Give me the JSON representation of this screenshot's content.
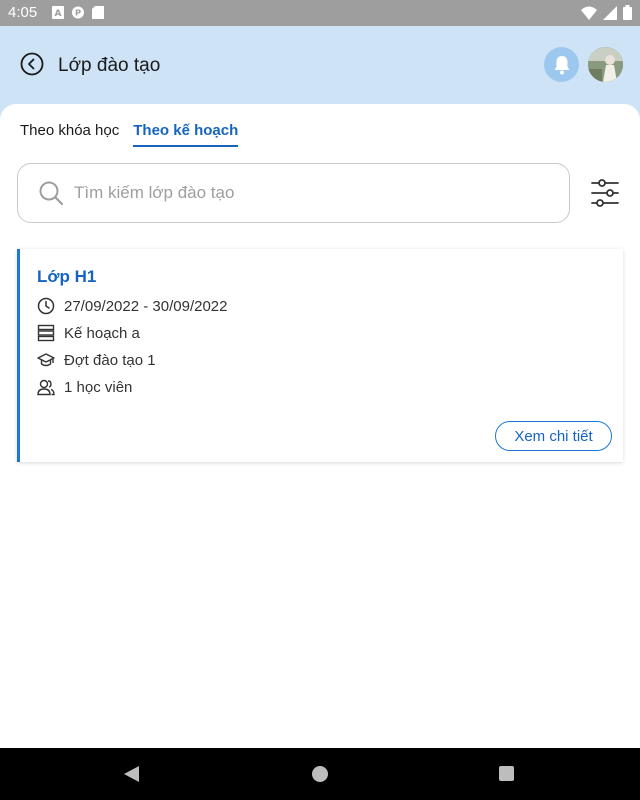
{
  "status_bar": {
    "time": "4:05",
    "left_icons": [
      "a-icon",
      "p-icon",
      "sd-card-icon"
    ],
    "right_icons": [
      "wifi-icon",
      "signal-icon",
      "battery-icon"
    ]
  },
  "header": {
    "title": "Lớp đào tạo",
    "back_icon": "back-circle-icon",
    "bell_icon": "bell-icon",
    "avatar": "user-avatar"
  },
  "tabs": [
    {
      "label": "Theo khóa học",
      "active": false
    },
    {
      "label": "Theo kế hoạch",
      "active": true
    }
  ],
  "search": {
    "placeholder": "Tìm kiếm lớp đào tạo",
    "value": ""
  },
  "filter_icon": "sliders-icon",
  "card": {
    "title": "Lớp H1",
    "date_range": "27/09/2022 - 30/09/2022",
    "plan": "Kế hoạch a",
    "batch": "Đợt đào tạo 1",
    "students": "1 học viên",
    "button_label": "Xem chi tiết"
  },
  "nav_bar": {
    "icons": [
      "nav-back-icon",
      "nav-home-icon",
      "nav-recent-icon"
    ]
  },
  "colors": {
    "accent": "#1565c0",
    "header_bg": "#cfe3f7",
    "card_border": "#1e78d4"
  }
}
